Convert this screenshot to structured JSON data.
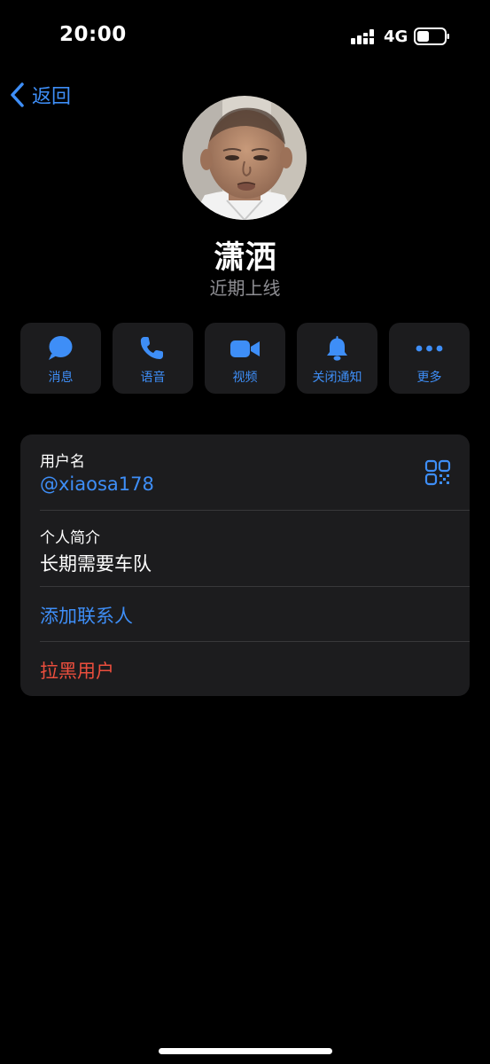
{
  "status_bar": {
    "time": "20:00",
    "network": "4G"
  },
  "nav": {
    "back_label": "返回"
  },
  "profile": {
    "name": "潇洒",
    "status": "近期上线"
  },
  "actions": [
    {
      "label": "消息",
      "icon": "message-bubble-icon"
    },
    {
      "label": "语音",
      "icon": "phone-icon"
    },
    {
      "label": "视频",
      "icon": "video-camera-icon"
    },
    {
      "label": "关闭通知",
      "icon": "bell-icon"
    },
    {
      "label": "更多",
      "icon": "more-dots-icon"
    }
  ],
  "info": {
    "username_label": "用户名",
    "username_value": "@xiaosa178",
    "bio_label": "个人简介",
    "bio_value": "长期需要车队",
    "add_contact_label": "添加联系人",
    "block_label": "拉黑用户"
  },
  "colors": {
    "accent": "#3e8ef7",
    "danger": "#eb4e3d",
    "card_background": "#1c1c1e",
    "secondary_text": "#8e8e93"
  }
}
